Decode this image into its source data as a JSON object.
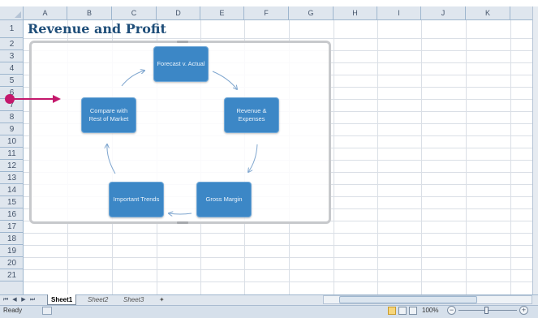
{
  "columns": [
    "A",
    "B",
    "C",
    "D",
    "E",
    "F",
    "G",
    "H",
    "I",
    "J",
    "K"
  ],
  "rows": [
    "1",
    "2",
    "3",
    "4",
    "5",
    "6",
    "7",
    "8",
    "9",
    "10",
    "11",
    "12",
    "13",
    "14",
    "15",
    "16",
    "17",
    "18",
    "19",
    "20",
    "21"
  ],
  "sheet_title": "Revenue and Profit",
  "smartart": {
    "nodes": [
      {
        "label": "Forecast v. Actual"
      },
      {
        "label": "Revenue & Expenses"
      },
      {
        "label": "Gross Margin"
      },
      {
        "label": "Important Trends"
      },
      {
        "label": "Compare with Rest of Market"
      }
    ]
  },
  "sheet_tabs": [
    "Sheet1",
    "Sheet2",
    "Sheet3"
  ],
  "active_tab": "Sheet1",
  "status": {
    "ready_text": "Ready",
    "zoom": "100%"
  },
  "colors": {
    "node_fill": "#3c87c6",
    "title_color": "#1f4e79",
    "pointer": "#c4186c"
  }
}
